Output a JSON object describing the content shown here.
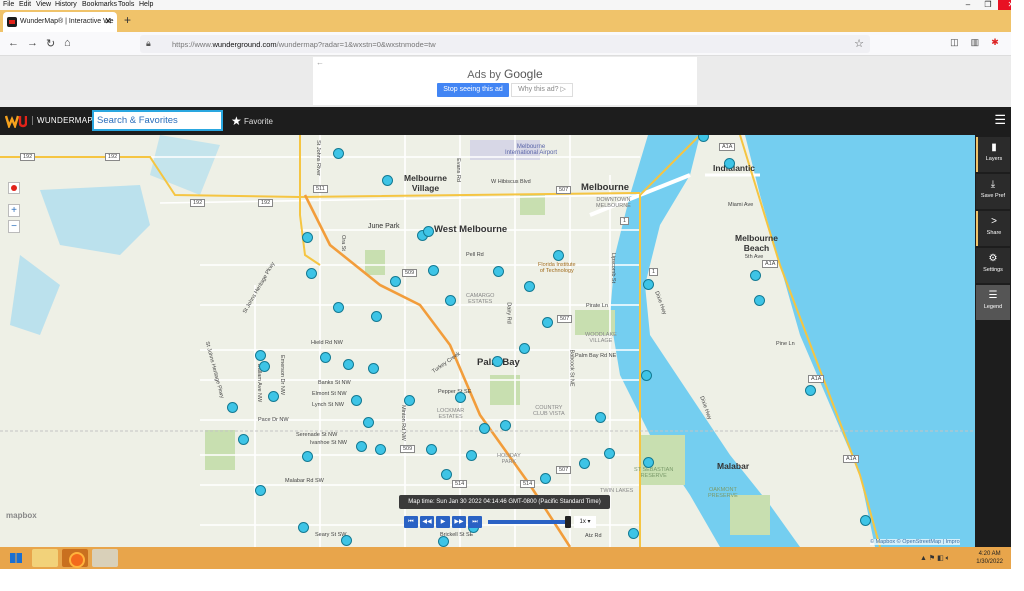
{
  "browser": {
    "menu": [
      "File",
      "Edit",
      "View",
      "History",
      "Bookmarks",
      "Tools",
      "Help"
    ],
    "tab_title": "WunderMap® | Interactive We",
    "url_prefix": "https://www.",
    "url_domain": "wunderground.com",
    "url_rest": "/wundermap?radar=1&wxstn=0&wxstnmode=tw"
  },
  "ad": {
    "ads_by": "Ads by",
    "brand": "Google",
    "stop_label": "Stop seeing this ad",
    "why_label": "Why this ad? ▷"
  },
  "header": {
    "brand": "WUNDERMAP",
    "search_placeholder": "Search & Favorites",
    "favorite_label": "Favorite"
  },
  "map": {
    "places": {
      "melbourne_village": [
        "Melbourne",
        "Village"
      ],
      "melbourne": "Melbourne",
      "west_melbourne": "West Melbourne",
      "melbourne_beach": [
        "Melbourne",
        "Beach"
      ],
      "palm_bay": "Palm Bay",
      "malabar": "Malabar",
      "indialantic": "Indialantic",
      "june_park": "June Park",
      "airport": [
        "Melbourne",
        "International Airport"
      ],
      "downtown": [
        "DOWNTOWN",
        "MELBOURNE"
      ],
      "fit": [
        "Florida Institute",
        "of Technology"
      ],
      "camargo": [
        "CAMARGO",
        "ESTATES"
      ],
      "woodlake": [
        "WOODLAKE",
        "VILLAGE"
      ],
      "country_club": [
        "COUNTRY",
        "CLUB VISTA"
      ],
      "lockmar": [
        "LOCKMAR",
        "ESTATES"
      ],
      "holiday_park": [
        "HOLIDAY",
        "PARK"
      ],
      "st_sebastian": [
        "ST SEBASTIAN",
        "RESERVE"
      ],
      "oakmont": [
        "OAKMONT",
        "PRESERVE"
      ],
      "twin_lakes": "TWIN LAKES"
    },
    "streets": {
      "w_hibiscus": "W Hibiscus Blvd",
      "pirate_ln": "Pirate Ln",
      "palm_bay_rd": "Palm Bay Rd NE",
      "banks_st": "Banks St NW",
      "elmont": "Elmont St NW",
      "lynch": "Lynch St NW",
      "pace_dr": "Pace Dr NW",
      "serenade": "Serenade St NW",
      "ivanhoe": "Ivanhoe St NW",
      "malabar_rd": "Malabar Rd SW",
      "seary": "Seary St SW",
      "brickell": "Brickell St SE",
      "pepper": "Pepper St SE",
      "hield": "Hield Rd NW",
      "miami_ave": "Miami Ave",
      "pine_ln": "Pine Ln",
      "fifth_ave": "5th Ave",
      "sjhp": "St Johns Heritage Pkwy",
      "sjhp2": "St Johns Heritage Pkwy",
      "dixie": "Dixie Hwy",
      "dixie2": "Dixie Hwy",
      "babcock": "Babcock St NE",
      "lipscomb": "Lipscomb St",
      "minton": "Minton Rd NW",
      "dairy": "Dairy Rd",
      "evans": "Evans Rd",
      "st_johns_river": "St Johns River",
      "atz": "Atz Rd",
      "dallam": "Dallam Ave NW",
      "emerson": "Emerson Dr NW",
      "pell": "Pell Rd",
      "ora": "Ora St",
      "turkey": "Turkey Creek"
    },
    "shields": [
      "192",
      "192",
      "192",
      "192",
      "511",
      "507",
      "509",
      "507",
      "509",
      "514",
      "514",
      "507",
      "1",
      "1",
      "A1A",
      "A1A",
      "A1A",
      "A1A"
    ],
    "mapbox_logo": "mapbox",
    "attribution": "© Mapbox © OpenStreetMap | Impro"
  },
  "timeline": {
    "map_time": "Map time: Sun Jan 30 2022 04:14:46 GMT-0800 (Pacific Standard Time)",
    "speed": "1x"
  },
  "rail": {
    "layers": "Layers",
    "save_pref": "Save Pref",
    "share": "Share",
    "settings": "Settings",
    "legend": "Legend"
  },
  "taskbar": {
    "time": "4:20 AM",
    "date": "1/30/2022"
  }
}
